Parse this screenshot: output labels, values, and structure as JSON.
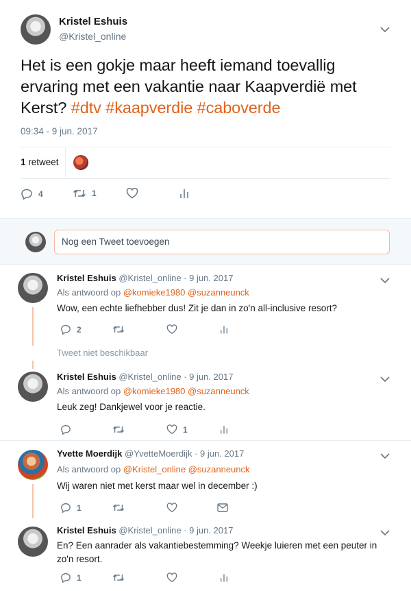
{
  "tweet": {
    "author_name": "Kristel Eshuis",
    "author_handle": "@Kristel_online",
    "text_plain": "Het is een gokje maar heeft iemand toevallig ervaring met een vakantie naar Kaapverdië met Kerst?",
    "hashtags": [
      "#dtv",
      "#kaapverdie",
      "#caboverde"
    ],
    "timestamp": "09:34 - 9 jun. 2017",
    "retweet_count": "1",
    "retweet_label": "retweet",
    "reply_count": "4",
    "retweet_action_count": "1"
  },
  "compose": {
    "placeholder": "Nog een Tweet toevoegen"
  },
  "replies": [
    {
      "name": "Kristel Eshuis",
      "handle_date": "@Kristel_online · 9 jun. 2017",
      "replying_prefix": "Als antwoord op",
      "replying_to": "@komieke1980 @suzanneunck",
      "text": "Wow, een echte liefhebber dus! Zit je dan in zo'n all-inclusive resort?",
      "reply_count": "2",
      "like_count": ""
    },
    {
      "name": "Kristel Eshuis",
      "handle_date": "@Kristel_online · 9 jun. 2017",
      "replying_prefix": "Als antwoord op",
      "replying_to": "@komieke1980 @suzanneunck",
      "text": "Leuk zeg! Dankjewel voor je reactie.",
      "reply_count": "",
      "like_count": "1"
    },
    {
      "name": "Yvette Moerdijk",
      "handle_date": "@YvetteMoerdijk · 9 jun. 2017",
      "replying_prefix": "Als antwoord op",
      "replying_to": "@Kristel_online @suzanneunck",
      "text": "Wij waren niet met kerst maar wel in december :)",
      "reply_count": "1",
      "like_count": ""
    },
    {
      "name": "Kristel Eshuis",
      "handle_date": "@Kristel_online · 9 jun. 2017",
      "replying_prefix": "",
      "replying_to": "",
      "text": "En? Een aanrader als vakantiebestemming? Weekje luieren met een peuter in zo'n resort.",
      "reply_count": "1",
      "like_count": ""
    }
  ],
  "unavailable_label": "Tweet niet beschikbaar",
  "colors": {
    "accent": "#e0631c",
    "muted": "#657786",
    "divider": "#e6ecf0",
    "thread_line": "#f7c2aa"
  }
}
